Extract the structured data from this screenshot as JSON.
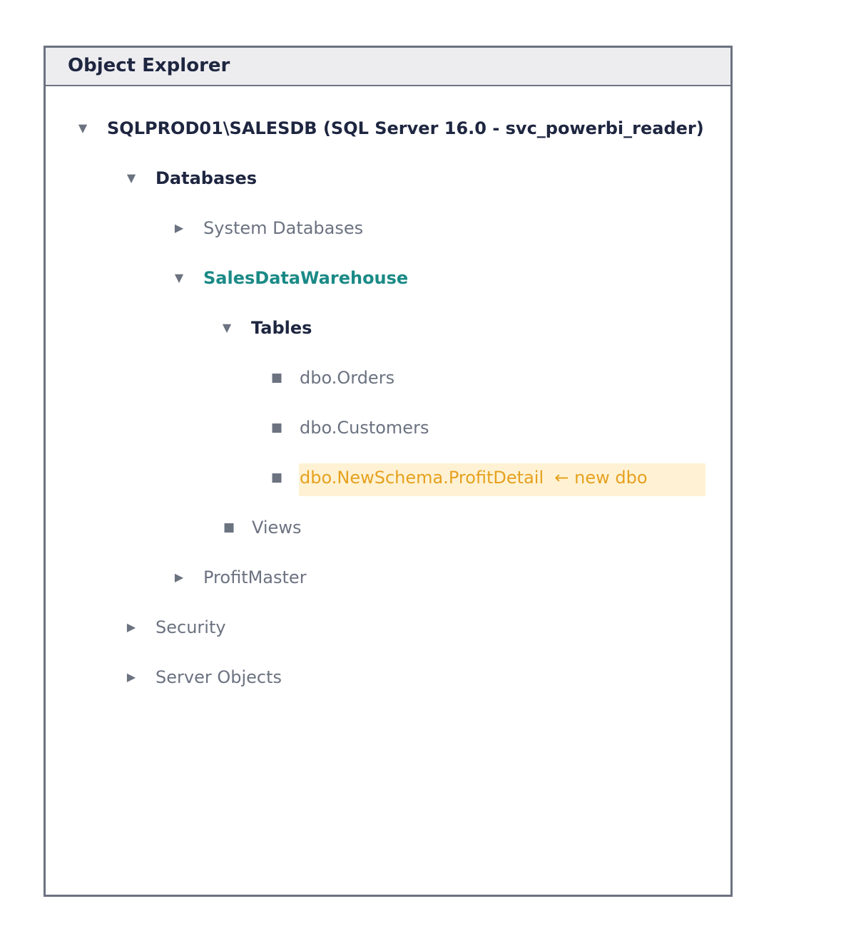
{
  "panel": {
    "title": "Object Explorer"
  },
  "tree": {
    "server": {
      "label": "SQLPROD01\\SALESDB (SQL Server 16.0 - svc_powerbi_reader)",
      "state": "expanded"
    },
    "databases": {
      "label": "Databases",
      "state": "expanded"
    },
    "system_databases": {
      "label": "System Databases",
      "state": "collapsed"
    },
    "sales_dw": {
      "label": "SalesDataWarehouse",
      "state": "expanded"
    },
    "tables": {
      "label": "Tables",
      "state": "expanded"
    },
    "table_items": [
      {
        "label": "dbo.Orders"
      },
      {
        "label": "dbo.Customers"
      },
      {
        "label": "dbo.NewSchema.ProfitDetail  ← new dbo",
        "highlighted": true
      }
    ],
    "views": {
      "label": "Views"
    },
    "profit_master": {
      "label": "ProfitMaster",
      "state": "collapsed"
    },
    "security": {
      "label": "Security",
      "state": "collapsed"
    },
    "server_objects": {
      "label": "Server Objects",
      "state": "collapsed"
    }
  },
  "glyphs": {
    "expanded": "▼",
    "collapsed": "▶",
    "leaf": "■"
  },
  "colors": {
    "text_dark": "#1e2640",
    "text_muted": "#6b7280",
    "accent_teal": "#1a8a86",
    "highlight_amber": "#e6a11f",
    "highlight_bg": "#fff2d4",
    "header_bg": "#ededf0",
    "border": "#6b7280"
  }
}
